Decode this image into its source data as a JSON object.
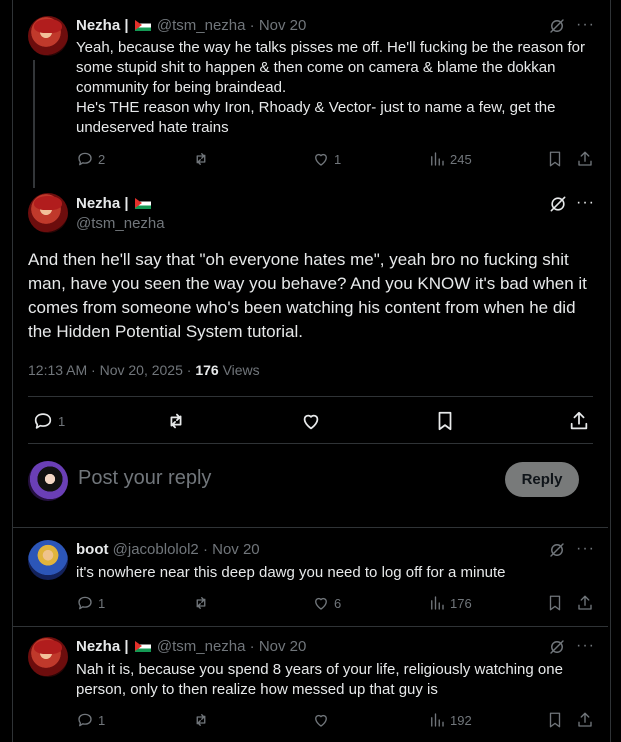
{
  "tweets": [
    {
      "name": "Nezha |",
      "handle": "@tsm_nezha",
      "sep": "·",
      "date": "Nov 20",
      "text": "Yeah, because the way he talks pisses me off. He'll fucking be the reason for some stupid shit to happen & then come on camera & blame the dokkan community for being braindead.\nHe's THE reason why Iron, Rhoady & Vector- just to name a few, get the undeserved hate trains",
      "replies": "2",
      "reposts": "",
      "likes": "1",
      "views": "245"
    },
    {
      "name": "boot",
      "handle": "@jacoblolol2",
      "sep": "·",
      "date": "Nov 20",
      "text": "it's nowhere near this deep dawg you need to log off for a minute",
      "replies": "1",
      "reposts": "",
      "likes": "6",
      "views": "176"
    },
    {
      "name": "Nezha |",
      "handle": "@tsm_nezha",
      "sep": "·",
      "date": "Nov 20",
      "text": "Nah it is, because you spend 8 years of your life, religiously watching one person, only to then realize how messed up that guy is",
      "replies": "1",
      "reposts": "",
      "likes": "",
      "views": "192"
    }
  ],
  "main": {
    "name": "Nezha |",
    "handle": "@tsm_nezha",
    "text": "And then he'll say that \"oh everyone hates me\", yeah bro no fucking shit man, have you seen the way you behave? And you KNOW it's bad when it comes from someone who's been watching his content from when he did the Hidden Potential System tutorial.",
    "time": "12:13 AM · Nov 20, 2025 · ",
    "views_count": "176",
    "views_label": " Views",
    "replies": "1"
  },
  "composer": {
    "placeholder": "Post your reply",
    "button": "Reply"
  },
  "more_glyph": "···",
  "colors": {
    "background": "#000000",
    "text": "#e7e9ea",
    "muted": "#71767b",
    "border": "#2f3336",
    "reply_button": "#787a7a"
  },
  "icons": [
    "grok-icon",
    "more-icon",
    "reply-icon",
    "repost-icon",
    "like-icon",
    "views-icon",
    "bookmark-icon",
    "share-icon",
    "flag-icon"
  ]
}
